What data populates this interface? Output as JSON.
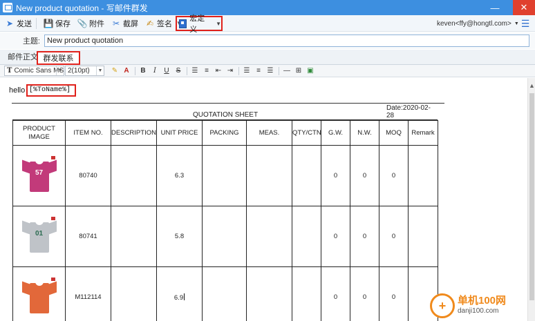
{
  "window": {
    "title": "New product quotation - 写邮件群发",
    "minimize": "—",
    "close": "✕"
  },
  "toolbar": {
    "send": "发送",
    "save": "保存",
    "attach": "附件",
    "screenshot": "截屏",
    "signature": "签名",
    "macro": "宏定义",
    "account": "keven<ffy@hongtl.com>"
  },
  "subject": {
    "label": "主题:",
    "value": "New product quotation"
  },
  "tabs": {
    "body": "邮件正文",
    "contacts": "群发联系人"
  },
  "format": {
    "font": "Comic Sans MS",
    "size": "2(10pt)"
  },
  "editor": {
    "greeting": "hello",
    "placeholder": "[%ToName%]"
  },
  "sheet": {
    "date": "Date:2020-02-28",
    "heading": "QUOTATION SHEET",
    "columns": [
      "PRODUCT IMAGE",
      "ITEM NO.",
      "DESCRIPTION",
      "UNIT PRICE",
      "PACKING",
      "MEAS.",
      "QTY/CTN",
      "G.W.",
      "N.W.",
      "MOQ",
      "Remark"
    ],
    "rows": [
      {
        "item": "80740",
        "price": "6.3",
        "gw": "0",
        "nw": "0",
        "moq": "0",
        "shirt_color": "#c23a7a",
        "print": "57"
      },
      {
        "item": "80741",
        "price": "5.8",
        "gw": "0",
        "nw": "0",
        "moq": "0",
        "shirt_color": "#bfc3c8",
        "print": "01"
      },
      {
        "item": "M112114",
        "price": "6.9",
        "gw": "0",
        "nw": "0",
        "moq": "0",
        "shirt_color": "#e2683a",
        "print": ""
      }
    ]
  },
  "watermark": {
    "site": "单机100网",
    "domain": "danji100.com",
    "symbol": "+"
  }
}
